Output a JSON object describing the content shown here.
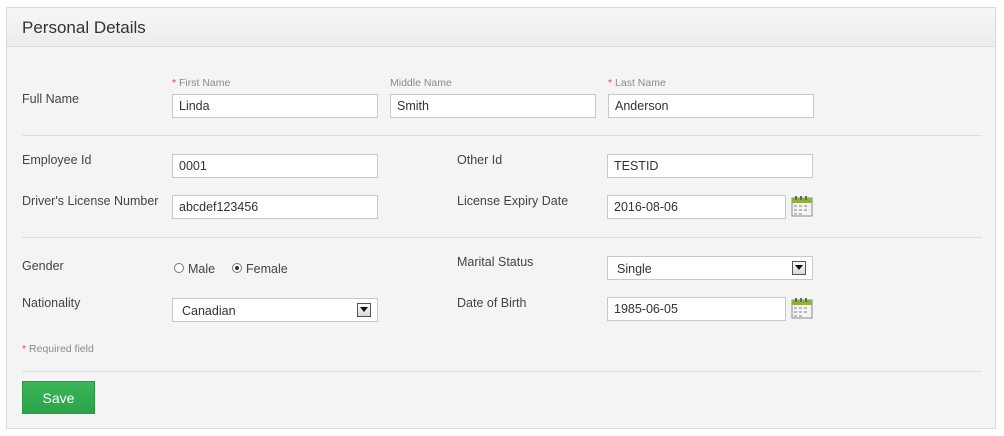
{
  "panel": {
    "title": "Personal Details"
  },
  "full_name": {
    "label": "Full Name",
    "first": {
      "label": "First Name",
      "required_mark": "*",
      "value": "Linda"
    },
    "middle": {
      "label": "Middle Name",
      "value": "Smith"
    },
    "last": {
      "label": "Last Name",
      "required_mark": "*",
      "value": "Anderson"
    }
  },
  "employee_id": {
    "label": "Employee Id",
    "value": "0001"
  },
  "other_id": {
    "label": "Other Id",
    "value": "TESTID"
  },
  "license_number": {
    "label": "Driver's License Number",
    "value": "abcdef123456"
  },
  "license_expiry": {
    "label": "License Expiry Date",
    "value": "2016-08-06"
  },
  "gender": {
    "label": "Gender",
    "options": [
      "Male",
      "Female"
    ],
    "selected": "Female"
  },
  "marital_status": {
    "label": "Marital Status",
    "value": "Single"
  },
  "nationality": {
    "label": "Nationality",
    "value": "Canadian"
  },
  "dob": {
    "label": "Date of Birth",
    "value": "1985-06-05"
  },
  "required_note": {
    "mark": "*",
    "text": "Required field"
  },
  "save_label": "Save",
  "colors": {
    "save": "#2ea043",
    "required": "#e04b4b"
  },
  "icons": {
    "calendar": "calendar-icon",
    "dropdown": "chevron-down-icon"
  }
}
